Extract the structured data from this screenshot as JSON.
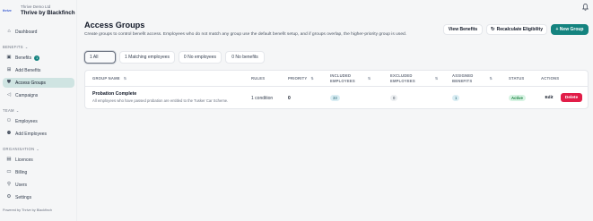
{
  "brand": {
    "logo_text": "thrive",
    "company": "Thrive Demo Ltd",
    "name": "Thrive by Blackfinch"
  },
  "sidebar": {
    "dashboard": "Dashboard",
    "benefits_section": "BENEFITS",
    "benefits": "Benefits",
    "benefits_badge": "1",
    "add_benefits": "Add Benefits",
    "access_groups": "Access Groups",
    "campaigns": "Campaigns",
    "team_section": "TEAM",
    "employees": "Employees",
    "add_employees": "Add Employees",
    "org_section": "ORGANISATION",
    "licences": "Licences",
    "billing": "Billing",
    "users": "Users",
    "settings": "Settings",
    "powered_by": "Powered by Thrive by Blackfinch"
  },
  "header": {
    "title": "Access Groups",
    "subtitle": "Create groups to control benefit access. Employees who do not match any group use the default benefit setup, and if groups overlap, the higher-priority group is used.",
    "view_benefits": "View Benefits",
    "recalculate": "Recalculate Eligibility",
    "new_group": "+ New Group"
  },
  "filters": {
    "all": "1 All",
    "matching": "1 Matching employees",
    "no_employees": "0 No employees",
    "no_benefits": "0 No benefits"
  },
  "table": {
    "headers": {
      "group_name": "GROUP NAME",
      "rules": "RULES",
      "priority": "PRIORITY",
      "included_1": "INCLUDED",
      "included_2": "EMPLOYEES",
      "excluded_1": "EXCLUDED",
      "excluded_2": "EMPLOYEES",
      "assigned_1": "ASSIGNED",
      "assigned_2": "BENEFITS",
      "status": "STATUS",
      "actions": "ACTIONS"
    },
    "rows": [
      {
        "name": "Probation Complete",
        "description": "All employees who have passed probation are entitled to the Tusker Car Scheme.",
        "rules": "1 condition",
        "priority": "0",
        "included": "33",
        "excluded": "0",
        "assigned": "1",
        "status": "Active",
        "edit": "Edit",
        "delete": "Delete"
      }
    ]
  },
  "colors": {
    "accent": "#14837f",
    "active_nav": "#cfe4e2",
    "delete": "#e11d48",
    "status_active": "#d7f3e3"
  }
}
